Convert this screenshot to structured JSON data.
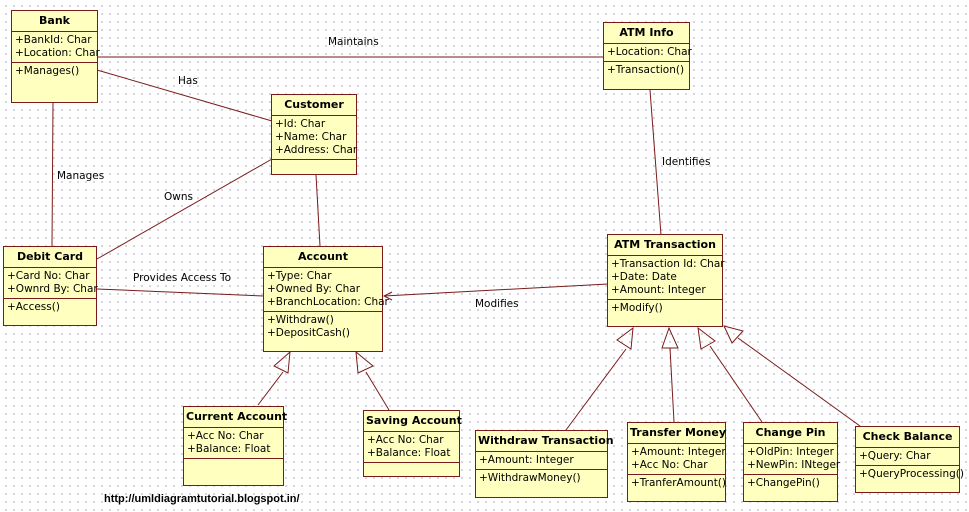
{
  "classes": {
    "bank": {
      "name": "Bank",
      "attrs": [
        "+BankId: Char",
        "+Location: Char"
      ],
      "ops": [
        "+Manages()"
      ]
    },
    "atm_info": {
      "name": "ATM Info",
      "attrs": [
        "+Location: Char"
      ],
      "ops": [
        "+Transaction()"
      ]
    },
    "customer": {
      "name": "Customer",
      "attrs": [
        "+Id: Char",
        "+Name: Char",
        "+Address: Char"
      ],
      "ops": []
    },
    "debit_card": {
      "name": "Debit Card",
      "attrs": [
        "+Card No: Char",
        "+Ownrd By: Char"
      ],
      "ops": [
        "+Access()"
      ]
    },
    "account": {
      "name": "Account",
      "attrs": [
        "+Type: Char",
        "+Owned By: Char",
        "+BranchLocation: Char"
      ],
      "ops": [
        "+Withdraw()",
        "+DepositCash()"
      ]
    },
    "atm_transaction": {
      "name": "ATM Transaction",
      "attrs": [
        "+Transaction Id: Char",
        "+Date: Date",
        "+Amount: Integer"
      ],
      "ops": [
        "+Modify()"
      ]
    },
    "current_account": {
      "name": "Current Account",
      "attrs": [
        "+Acc No: Char",
        "+Balance: Float"
      ],
      "ops": []
    },
    "saving_account": {
      "name": "Saving Account",
      "attrs": [
        "+Acc No: Char",
        "+Balance: Float"
      ],
      "ops": []
    },
    "withdraw_transaction": {
      "name": "Withdraw Transaction",
      "attrs": [
        "+Amount: Integer"
      ],
      "ops": [
        "+WithdrawMoney()"
      ]
    },
    "transfer_money": {
      "name": "Transfer Money",
      "attrs": [
        "+Amount: Integer",
        "+Acc No: Char"
      ],
      "ops": [
        "+TranferAmount()"
      ]
    },
    "change_pin": {
      "name": "Change Pin",
      "attrs": [
        "+OldPin: Integer",
        "+NewPin: INteger"
      ],
      "ops": [
        "+ChangePin()"
      ]
    },
    "check_balance": {
      "name": "Check Balance",
      "attrs": [
        "+Query: Char"
      ],
      "ops": [
        "+QueryProcessing()"
      ]
    }
  },
  "associations": {
    "maintains": "Maintains",
    "has": "Has",
    "manages": "Manages",
    "owns": "Owns",
    "identifies": "Identifies",
    "provides_access_to": "Provides Access To",
    "modifies": "Modifies"
  },
  "footer": "http://umldiagramtutorial.blogspot.in/",
  "colors": {
    "fill": "#ffffc0",
    "line": "#7a1a1a"
  }
}
